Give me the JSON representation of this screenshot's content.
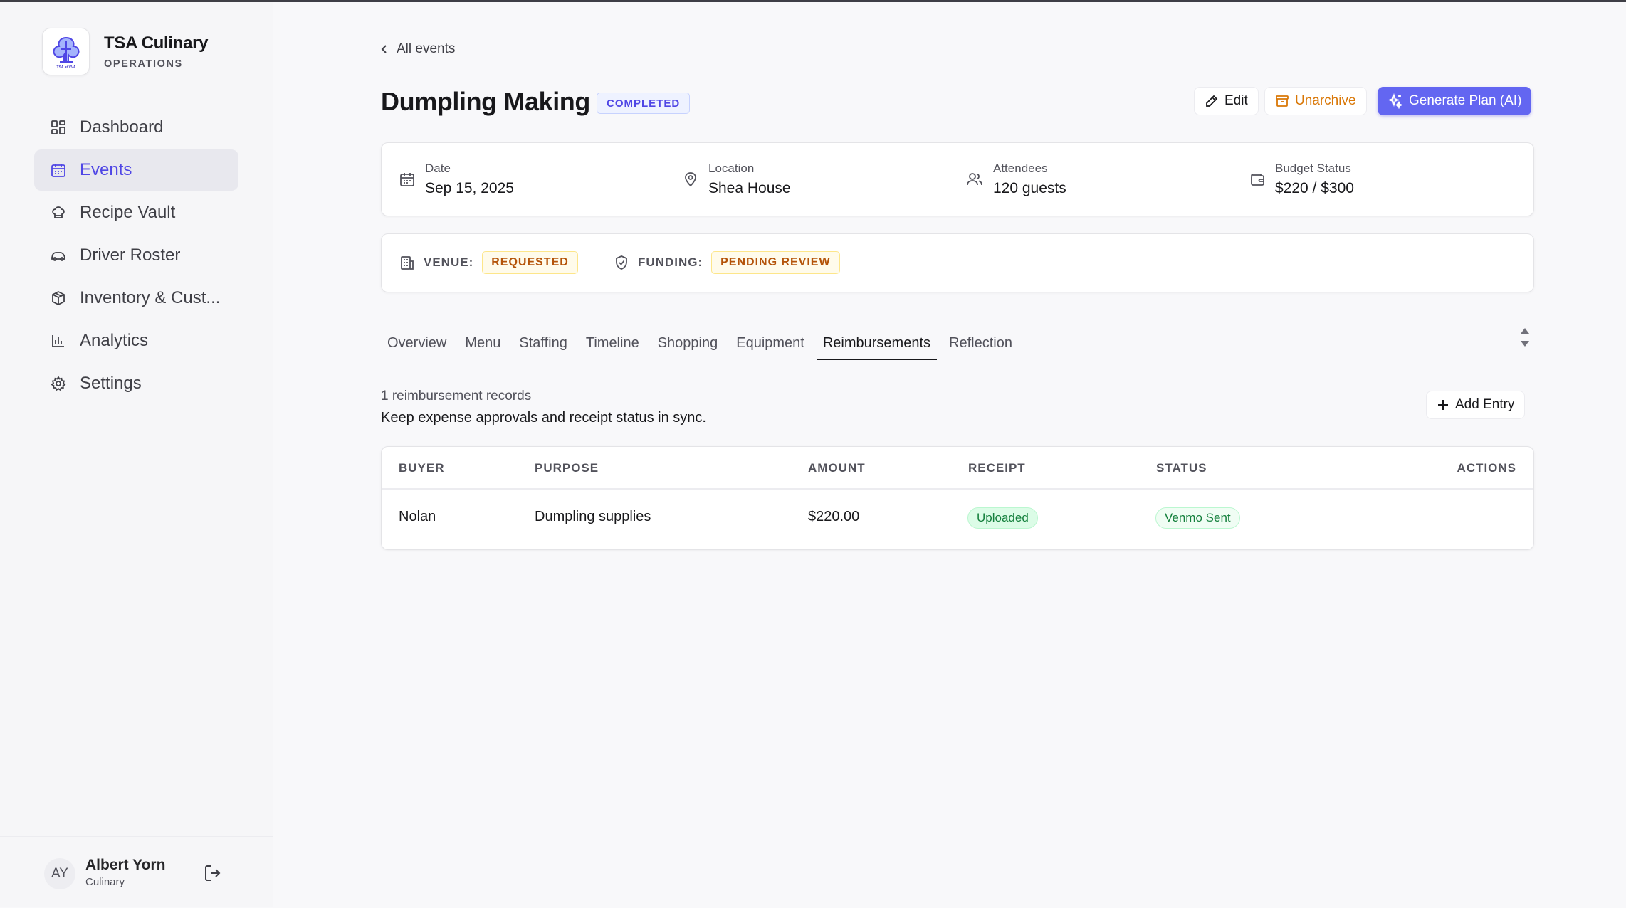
{
  "brand": {
    "name": "TSA Culinary",
    "subtitle": "OPERATIONS",
    "logo_text": "TSA at VVA"
  },
  "nav": [
    {
      "label": "Dashboard",
      "icon": "dashboard-icon"
    },
    {
      "label": "Events",
      "icon": "calendar-icon",
      "active": true
    },
    {
      "label": "Recipe Vault",
      "icon": "chef-hat-icon"
    },
    {
      "label": "Driver Roster",
      "icon": "car-icon"
    },
    {
      "label": "Inventory & Cust...",
      "icon": "package-icon"
    },
    {
      "label": "Analytics",
      "icon": "bar-chart-icon"
    },
    {
      "label": "Settings",
      "icon": "gear-icon"
    }
  ],
  "user": {
    "initials": "AY",
    "name": "Albert Yorn",
    "role": "Culinary"
  },
  "back_label": "All events",
  "event": {
    "title": "Dumpling Making",
    "status": "COMPLETED"
  },
  "actions": {
    "edit": "Edit",
    "unarchive": "Unarchive",
    "generate": "Generate Plan (AI)"
  },
  "info": {
    "date_label": "Date",
    "date_value": "Sep 15, 2025",
    "location_label": "Location",
    "location_value": "Shea House",
    "attendees_label": "Attendees",
    "attendees_value": "120 guests",
    "budget_label": "Budget Status",
    "budget_value": "$220 / $300"
  },
  "statuses": {
    "venue_label": "VENUE:",
    "venue_value": "REQUESTED",
    "funding_label": "FUNDING:",
    "funding_value": "PENDING REVIEW"
  },
  "tabs": [
    "Overview",
    "Menu",
    "Staffing",
    "Timeline",
    "Shopping",
    "Equipment",
    "Reimbursements",
    "Reflection"
  ],
  "active_tab": "Reimbursements",
  "reimbursements": {
    "count_text": "1 reimbursement records",
    "description": "Keep expense approvals and receipt status in sync.",
    "add_label": "Add Entry",
    "columns": [
      "BUYER",
      "PURPOSE",
      "AMOUNT",
      "RECEIPT",
      "STATUS",
      "ACTIONS"
    ],
    "rows": [
      {
        "buyer": "Nolan",
        "purpose": "Dumpling supplies",
        "amount": "$220.00",
        "receipt": "Uploaded",
        "status": "Venmo Sent"
      }
    ]
  },
  "colors": {
    "accent": "#6366f1",
    "warning": "#d97706",
    "success": "#15803d"
  }
}
